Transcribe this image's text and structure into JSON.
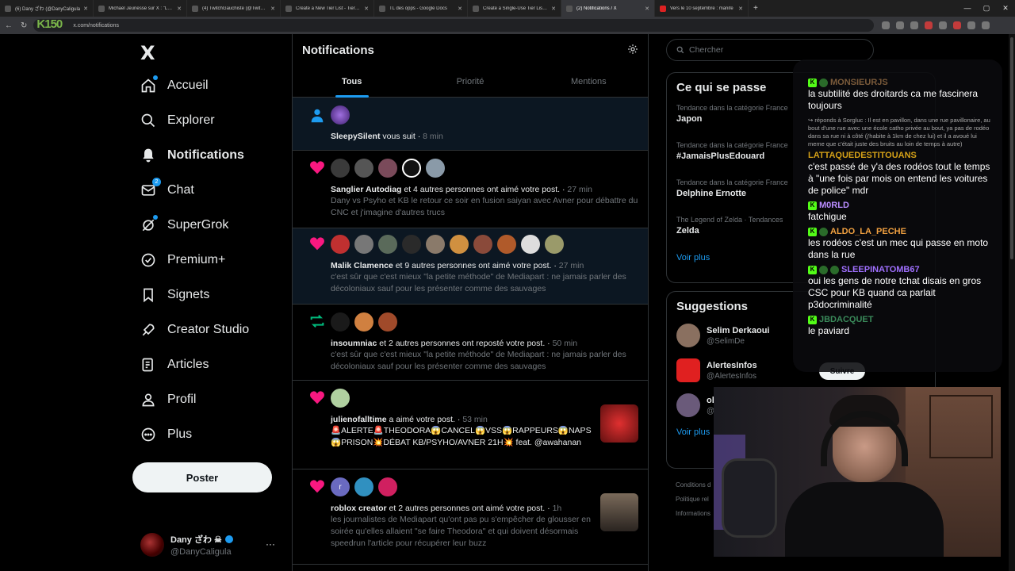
{
  "browser": {
    "tabs": [
      {
        "label": "(6) Dany ざわ (@DanyCaligula"
      },
      {
        "label": "Michael Jeunesse sur X : \"Le su"
      },
      {
        "label": "(4) TwitchGauchiste (@TwitchG"
      },
      {
        "label": "Create a New Tier List - TierMa"
      },
      {
        "label": "TL des opps - Google Docs"
      },
      {
        "label": "Create a Single-Use Tier List (F"
      },
      {
        "label": "(2) Notifications / X"
      },
      {
        "label": "Vers le 10 septembre : manife"
      }
    ],
    "url": "x.com/notifications",
    "overlay_brand": "K150"
  },
  "sidebar": {
    "logo": "X",
    "items": [
      {
        "label": "Accueil",
        "icon": "home-icon"
      },
      {
        "label": "Explorer",
        "icon": "search-icon"
      },
      {
        "label": "Notifications",
        "icon": "bell-icon"
      },
      {
        "label": "Chat",
        "icon": "mail-icon",
        "badge": "2"
      },
      {
        "label": "SuperGrok",
        "icon": "grok-icon"
      },
      {
        "label": "Premium+",
        "icon": "premium-icon"
      },
      {
        "label": "Signets",
        "icon": "bookmark-icon"
      },
      {
        "label": "Creator Studio",
        "icon": "rocket-icon"
      },
      {
        "label": "Articles",
        "icon": "articles-icon"
      },
      {
        "label": "Profil",
        "icon": "person-icon"
      },
      {
        "label": "Plus",
        "icon": "more-circle-icon"
      }
    ],
    "post_label": "Poster",
    "account": {
      "name": "Dany ざわ ☠",
      "handle": "@DanyCaligula",
      "more": "···"
    }
  },
  "main": {
    "title": "Notifications",
    "tabs": [
      "Tous",
      "Priorité",
      "Mentions"
    ],
    "notifications": [
      {
        "type": "follow",
        "actor": "SleepySilent",
        "action": " vous suit",
        "time": "8 min",
        "text": ""
      },
      {
        "type": "like",
        "actor": "Sanglier Autodiag",
        "action": " et 4 autres personnes ont aimé votre post.",
        "time": "27 min",
        "text": "Dany vs Psyho et KB le retour ce soir en fusion saiyan avec Avner pour débattre du CNC et j'imagine d'autres trucs"
      },
      {
        "type": "like",
        "actor": "Malik Clamence",
        "action": " et 9 autres personnes ont aimé votre post.",
        "time": "27 min",
        "text": "c'est sûr que c'est mieux \"la petite méthode\" de Mediapart : ne jamais parler des décoloniaux sauf pour les présenter comme des sauvages"
      },
      {
        "type": "repost",
        "actor": "insoumniac",
        "action": " et 2 autres personnes ont reposté votre post.",
        "time": "50 min",
        "text": "c'est sûr que c'est mieux \"la petite méthode\" de Mediapart : ne jamais parler des décoloniaux sauf pour les présenter comme des sauvages"
      },
      {
        "type": "like",
        "actor": "julienofalltime",
        "action": " a aimé votre post.",
        "time": "53 min",
        "text": "🚨ALERTE🚨THEODORA😱CANCEL😱VSS😱RAPPEURS😱NAPS😱PRISON💥DÉBAT KB/PSYHO/AVNER 21H💥 feat. @awahanan"
      },
      {
        "type": "like",
        "actor": "roblox creator",
        "action": " et 2 autres personnes ont aimé votre post.",
        "time": "1h",
        "text": "les journalistes de Mediapart qu'ont pas pu s'empêcher de glousser en soirée qu'elles allaient \"se faire Theodora\" et qui doivent désormais speedrun l'article pour récupérer leur buzz"
      }
    ],
    "avatar_initial": "r"
  },
  "right": {
    "search_placeholder": "Chercher",
    "trends_title": "Ce qui se passe",
    "trends": [
      {
        "category": "Tendance dans la catégorie France",
        "name": "Japon"
      },
      {
        "category": "Tendance dans la catégorie France",
        "name": "#JamaisPlusEdouard"
      },
      {
        "category": "Tendance dans la catégorie France",
        "name": "Delphine Ernotte"
      },
      {
        "category": "The Legend of Zelda · Tendances",
        "name": "Zelda"
      }
    ],
    "see_more": "Voir plus",
    "suggestions_title": "Suggestions",
    "suggestions": [
      {
        "name": "Selim Derkaoui",
        "handle": "@SelimDe"
      },
      {
        "name": "AlertesInfos",
        "handle": "@AlertesInfos"
      },
      {
        "name": "ok",
        "handle": "@"
      }
    ],
    "follow_label": "Suivre",
    "see_more_2": "Voir plus",
    "footer": [
      "Conditions d",
      "Politique rel",
      "Informations"
    ]
  },
  "chat_overlay": {
    "messages": [
      {
        "user": "MONSIEURJS",
        "color": "#7a5a3a",
        "text": "la subtilité des droitards ca me fascinera toujours",
        "reply": ""
      },
      {
        "user": "LATTAQUEDESTITOUANS",
        "color": "#d4a017",
        "text": "c'est passé de y'a des rodéos tout le temps à \"une fois par mois on entend les voitures de police\" mdr",
        "reply": "↪ réponds à Sorgluc : Il est en pavillon, dans une rue pavillonaire, au bout d'une rue avec une école catho privée au bout, ya pas de rodéo dans sa rue ni à côté (j'habite à 1km de chez lui) et il a avoué lui meme que c'était juste des bruits au loin de temps à autre)"
      },
      {
        "user": "M0RLD",
        "color": "#b98cff",
        "text": "fatchigue",
        "reply": ""
      },
      {
        "user": "ALDO_LA_PECHE",
        "color": "#f0a040",
        "text": "les rodéos c'est un mec qui passe en moto dans la rue",
        "reply": ""
      },
      {
        "user": "SLEEPINATOMB67",
        "color": "#a070ff",
        "text": "oui les gens de notre tchat disais en gros CSC pour KB quand ca parlait p3docriminalité",
        "reply": ""
      },
      {
        "user": "JBDACQUET",
        "color": "#3a8a5a",
        "text": "le paviard",
        "reply": ""
      }
    ]
  },
  "colors": {
    "accent": "#1d9bf0",
    "like": "#f91880",
    "repost": "#00ba7c",
    "background": "#000000"
  }
}
